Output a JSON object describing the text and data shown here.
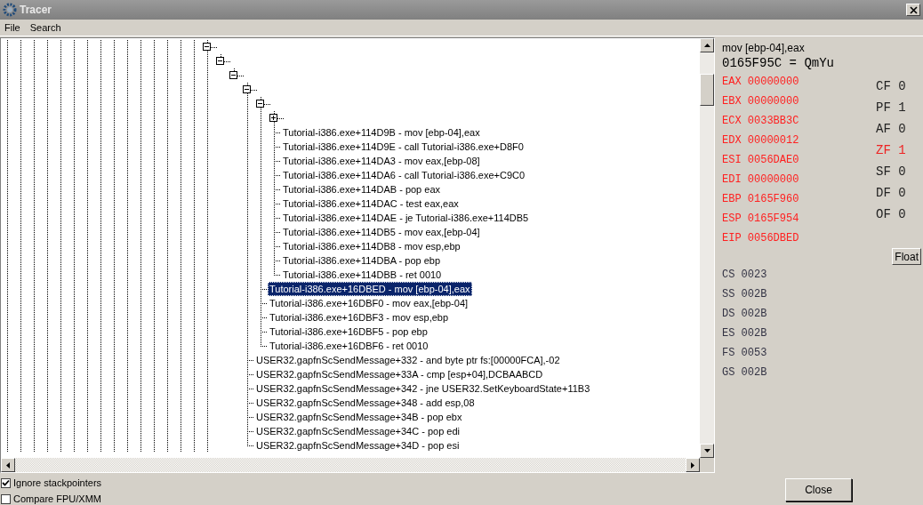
{
  "window": {
    "title": "Tracer"
  },
  "menu": [
    "File",
    "Search"
  ],
  "tree": {
    "nodes": [
      {
        "expanded": true,
        "children": [
          {
            "expanded": true,
            "children": [
              {
                "expanded": true,
                "children": [
                  {
                    "expanded": true,
                    "children": [
                      {
                        "expanded": true,
                        "children": [
                          {
                            "kind": "node",
                            "expanded": false
                          },
                          {
                            "text": "Tutorial-i386.exe+114D9B - mov [ebp-04],eax",
                            "selected": false
                          },
                          {
                            "text": "Tutorial-i386.exe+114D9E - call Tutorial-i386.exe+D8F0",
                            "selected": false
                          },
                          {
                            "text": "Tutorial-i386.exe+114DA3 - mov eax,[ebp-08]",
                            "selected": false
                          },
                          {
                            "text": "Tutorial-i386.exe+114DA6 - call Tutorial-i386.exe+C9C0",
                            "selected": false
                          },
                          {
                            "text": "Tutorial-i386.exe+114DAB - pop eax",
                            "selected": false
                          },
                          {
                            "text": "Tutorial-i386.exe+114DAC - test eax,eax",
                            "selected": false
                          },
                          {
                            "text": "Tutorial-i386.exe+114DAE - je Tutorial-i386.exe+114DB5",
                            "selected": false
                          },
                          {
                            "text": "Tutorial-i386.exe+114DB5 - mov eax,[ebp-04]",
                            "selected": false
                          },
                          {
                            "text": "Tutorial-i386.exe+114DB8 - mov esp,ebp",
                            "selected": false
                          },
                          {
                            "text": "Tutorial-i386.exe+114DBA - pop ebp",
                            "selected": false
                          },
                          {
                            "text": "Tutorial-i386.exe+114DBB - ret 0010",
                            "selected": false
                          }
                        ]
                      },
                      {
                        "text": "Tutorial-i386.exe+16DBED - mov [ebp-04],eax",
                        "selected": true
                      },
                      {
                        "text": "Tutorial-i386.exe+16DBF0 - mov eax,[ebp-04]",
                        "selected": false
                      },
                      {
                        "text": "Tutorial-i386.exe+16DBF3 - mov esp,ebp",
                        "selected": false
                      },
                      {
                        "text": "Tutorial-i386.exe+16DBF5 - pop ebp",
                        "selected": false
                      },
                      {
                        "text": "Tutorial-i386.exe+16DBF6 - ret 0010",
                        "selected": false
                      }
                    ]
                  },
                  {
                    "text": "USER32.gapfnScSendMessage+332 - and byte ptr fs:[00000FCA],-02",
                    "selected": false
                  },
                  {
                    "text": "USER32.gapfnScSendMessage+33A - cmp [esp+04],DCBAABCD",
                    "selected": false
                  },
                  {
                    "text": "USER32.gapfnScSendMessage+342 - jne USER32.SetKeyboardState+11B3",
                    "selected": false
                  },
                  {
                    "text": "USER32.gapfnScSendMessage+348 - add esp,08",
                    "selected": false
                  },
                  {
                    "text": "USER32.gapfnScSendMessage+34B - pop ebx",
                    "selected": false
                  },
                  {
                    "text": "USER32.gapfnScSendMessage+34C - pop edi",
                    "selected": false
                  },
                  {
                    "text": "USER32.gapfnScSendMessage+34D - pop esi",
                    "selected": false
                  }
                ]
              }
            ]
          }
        ]
      }
    ]
  },
  "detail": {
    "instruction": "mov [ebp-04],eax",
    "memory": "0165F95C = QmYu",
    "registers": [
      {
        "name": "EAX",
        "value": "00000000",
        "changed": true
      },
      {
        "name": "EBX",
        "value": "00000000",
        "changed": true
      },
      {
        "name": "ECX",
        "value": "0033BB3C",
        "changed": true
      },
      {
        "name": "EDX",
        "value": "00000012",
        "changed": true
      },
      {
        "name": "ESI",
        "value": "0056DAE0",
        "changed": true
      },
      {
        "name": "EDI",
        "value": "00000000",
        "changed": true
      },
      {
        "name": "EBP",
        "value": "0165F960",
        "changed": true
      },
      {
        "name": "ESP",
        "value": "0165F954",
        "changed": true
      },
      {
        "name": "EIP",
        "value": "0056DBED",
        "changed": true
      }
    ],
    "flags": [
      {
        "name": "CF",
        "value": "0",
        "changed": false
      },
      {
        "name": "PF",
        "value": "1",
        "changed": false
      },
      {
        "name": "AF",
        "value": "0",
        "changed": false
      },
      {
        "name": "ZF",
        "value": "1",
        "changed": true
      },
      {
        "name": "SF",
        "value": "0",
        "changed": false
      },
      {
        "name": "DF",
        "value": "0",
        "changed": false
      },
      {
        "name": "OF",
        "value": "0",
        "changed": false
      }
    ],
    "float_button": "Float",
    "segments": [
      {
        "name": "CS",
        "value": "0023"
      },
      {
        "name": "SS",
        "value": "002B"
      },
      {
        "name": "DS",
        "value": "002B"
      },
      {
        "name": "ES",
        "value": "002B"
      },
      {
        "name": "FS",
        "value": "0053"
      },
      {
        "name": "GS",
        "value": "002B"
      }
    ]
  },
  "options": [
    {
      "label": "Ignore stackpointers",
      "checked": true
    },
    {
      "label": "Compare FPU/XMM",
      "checked": false
    }
  ],
  "close_button": "Close"
}
